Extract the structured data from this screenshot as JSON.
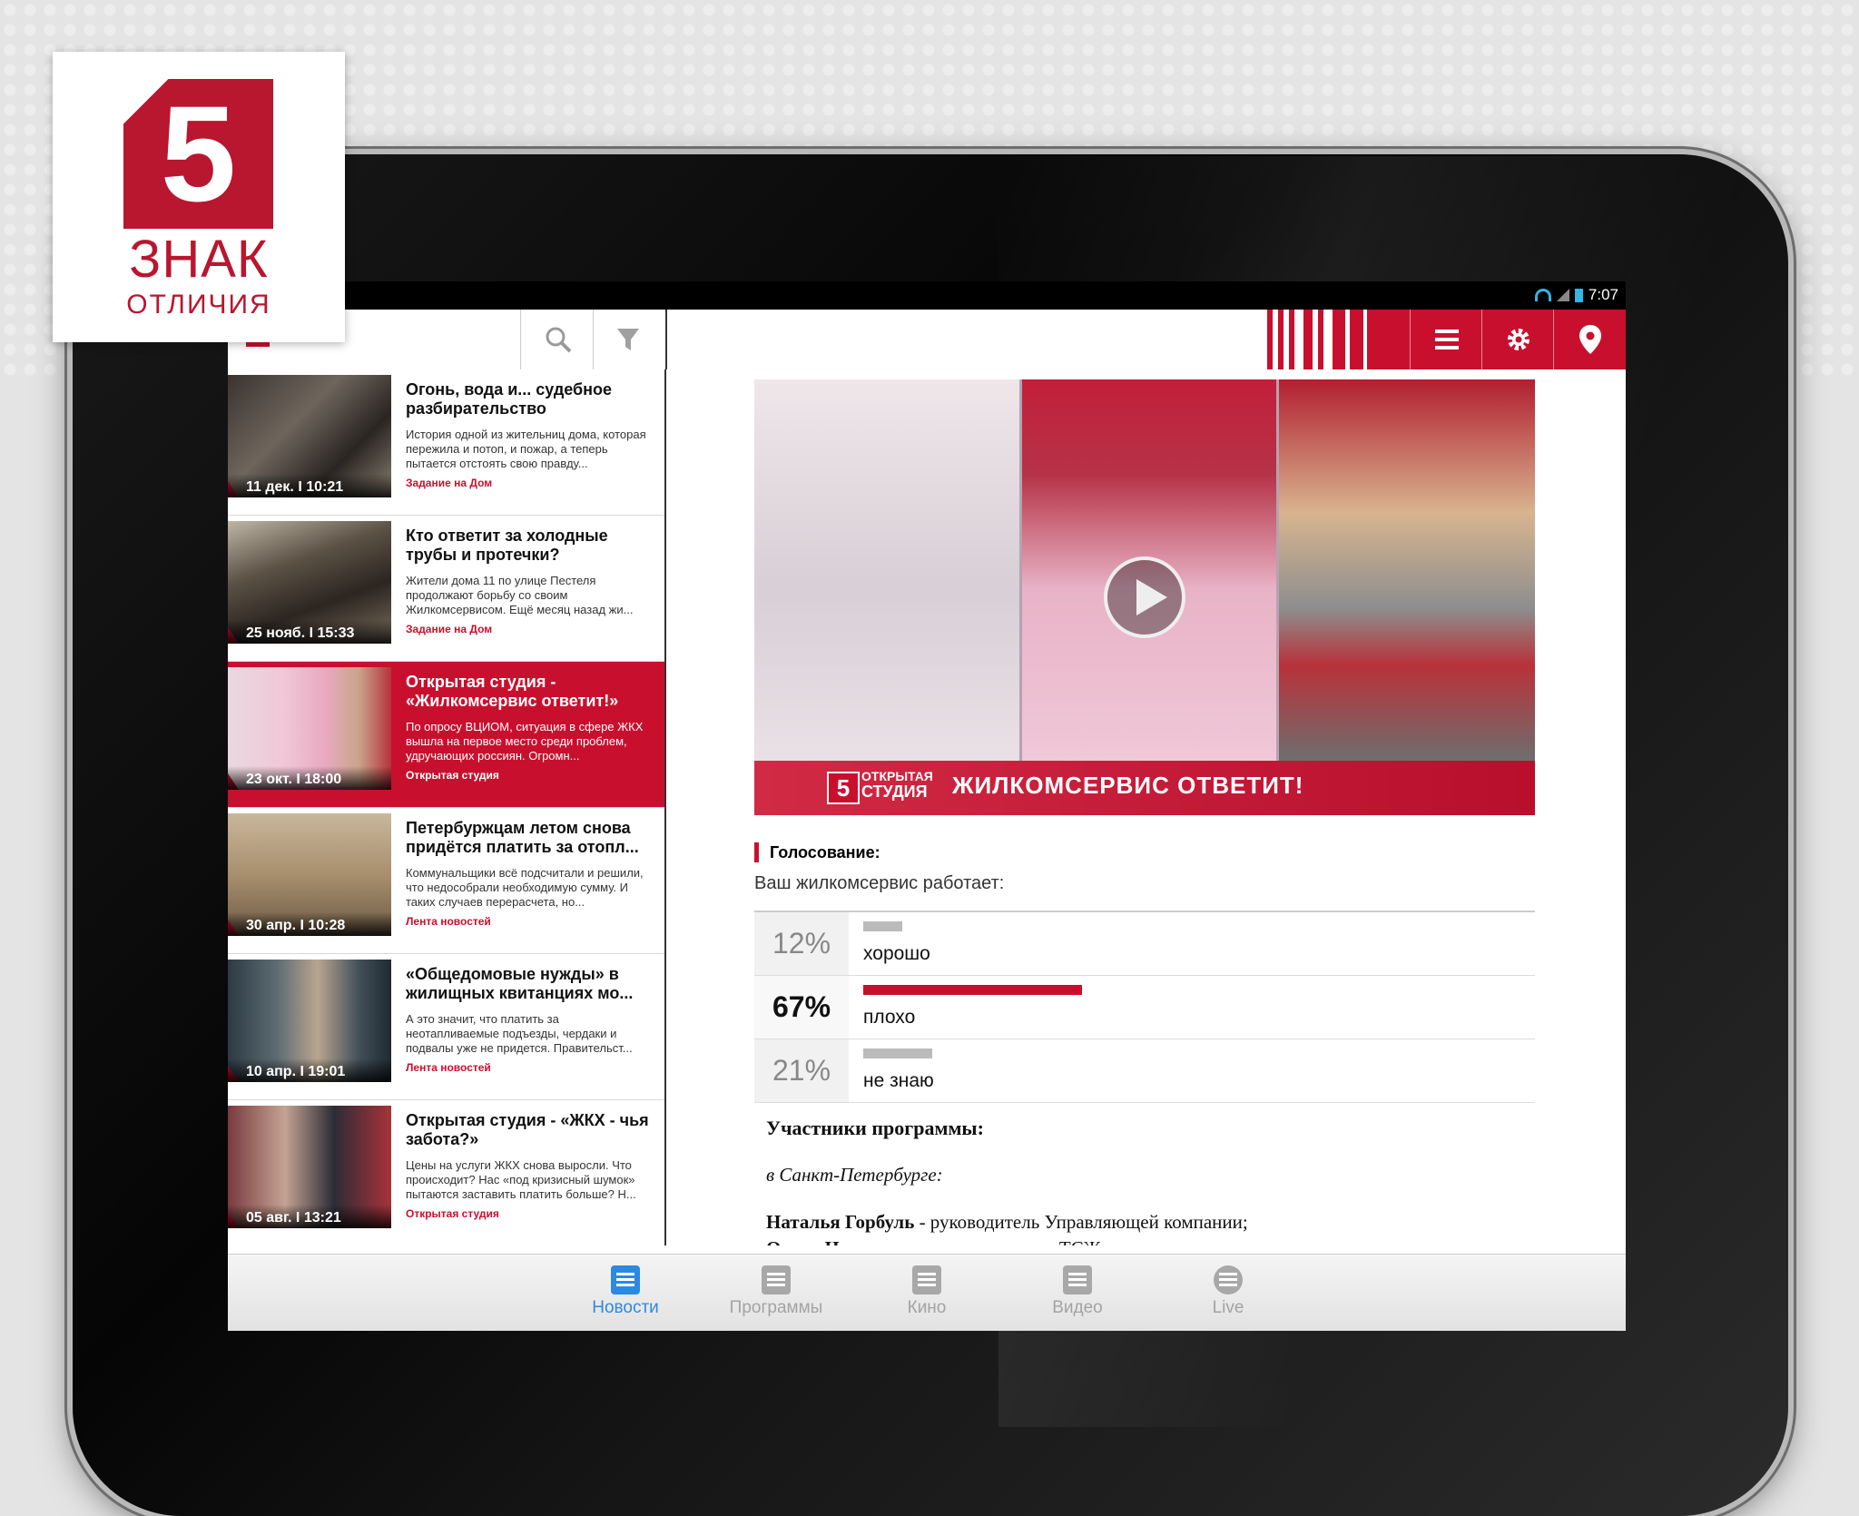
{
  "brand_logo": {
    "number": "5",
    "line1": "ЗНАК",
    "line2": "ОТЛИЧИЯ"
  },
  "status_bar": {
    "time": "7:07"
  },
  "colors": {
    "accent": "#c8102e",
    "tab_active": "#2b8ae0"
  },
  "top_bar": {
    "icons": [
      "back-arrow-icon",
      "search-icon",
      "filter-icon",
      "menu-icon",
      "gear-icon",
      "location-pin-icon"
    ]
  },
  "news": [
    {
      "title": "Огонь, вода и... судебное разбирательство",
      "excerpt": "История одной из жительниц дома, которая пережила и потоп, и пожар, а теперь пытается отстоять свою правду...",
      "tag": "Задание на Дом",
      "date": "11 дек. I 10:21"
    },
    {
      "title": "Кто ответит за холодные трубы и протечки?",
      "excerpt": "Жители дома 11 по улице Пестеля продолжают борьбу со своим Жилкомсервисом. Ещё месяц назад жи...",
      "tag": "Задание на Дом",
      "date": "25 нояб. I 15:33"
    },
    {
      "title": "Открытая студия - «Жилкомсервис ответит!»",
      "excerpt": "По опросу ВЦИОМ, ситуация в сфере ЖКХ вышла на первое место среди проблем, удручающих россиян. Огромн...",
      "tag": "Открытая студия",
      "date": "23 окт. I 18:00"
    },
    {
      "title": "Петербуржцам летом снова придётся платить за отопл...",
      "excerpt": "Коммунальщики всё подсчитали и решили, что недособрали необходимую сумму. И таких случаев перерасчета, но...",
      "tag": "Лента новостей",
      "date": "30 апр. I 10:28"
    },
    {
      "title": "«Общедомовые нужды» в жилищных квитанциях мо...",
      "excerpt": "А это значит, что платить за неотапливаемые подъезды, чердаки и подвалы уже не придется. Правительст...",
      "tag": "Лента новостей",
      "date": "10 апр. I 19:01"
    },
    {
      "title": "Открытая студия - «ЖКХ - чья забота?»",
      "excerpt": "Цены на услуги ЖКХ снова выросли. Что происходит? Нас «под кризисный шумок» пытаются заставить платить больше? Н...",
      "tag": "Открытая студия",
      "date": "05 авг. I 13:21"
    }
  ],
  "video": {
    "lower_third_small_1": "ОТКРЫТАЯ",
    "lower_third_small_2": "СТУДИЯ",
    "lower_third_title": "ЖИЛКОМСЕРВИС ОТВЕТИТ!",
    "logo": "5"
  },
  "poll": {
    "title": "Голосование:",
    "question": "Ваш жилкомсервис работает:",
    "options": [
      {
        "label": "хорошо",
        "percent_text": "12%",
        "percent": 12
      },
      {
        "label": "плохо",
        "percent_text": "67%",
        "percent": 67
      },
      {
        "label": "не знаю",
        "percent_text": "21%",
        "percent": 21
      }
    ]
  },
  "participants": {
    "heading": "Участники программы:",
    "city": "в Санкт-Петербурге:",
    "line1_name": "Наталья Горбуль",
    "line1_role": " - руководитель Управляющей компании;",
    "line2_name": "Ольга Цихновицер",
    "line2_role": " - председатель ТСЖ;"
  },
  "tabs": [
    {
      "label": "Новости",
      "icon": "news-icon"
    },
    {
      "label": "Программы",
      "icon": "programs-icon"
    },
    {
      "label": "Кино",
      "icon": "film-icon"
    },
    {
      "label": "Видео",
      "icon": "video-icon"
    },
    {
      "label": "Live",
      "icon": "live-globe-icon"
    }
  ]
}
